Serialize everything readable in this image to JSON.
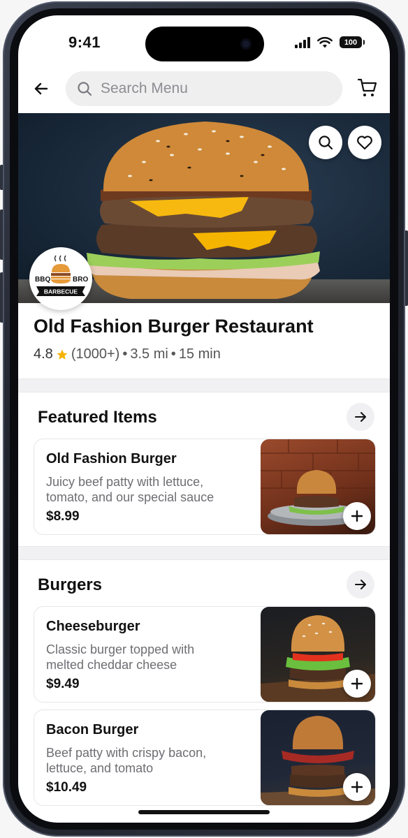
{
  "status_bar": {
    "time": "9:41",
    "battery": "100"
  },
  "header": {
    "search_placeholder": "Search Menu"
  },
  "logo": {
    "top_left": "BBQ",
    "top_right": "BRO",
    "ribbon": "BARBECUE"
  },
  "restaurant": {
    "name": "Old Fashion Burger Restaurant",
    "rating": "4.8",
    "reviews": "(1000+)",
    "distance": "3.5 mi",
    "time": "15 min"
  },
  "sections": [
    {
      "title": "Featured Items",
      "items": [
        {
          "name": "Old Fashion Burger",
          "description": "Juicy beef patty with lettuce, tomato, and our special sauce",
          "price": "$8.99"
        }
      ]
    },
    {
      "title": "Burgers",
      "items": [
        {
          "name": "Cheeseburger",
          "description": "Classic burger topped with melted cheddar cheese",
          "price": "$9.49"
        },
        {
          "name": "Bacon Burger",
          "description": "Beef patty with crispy bacon, lettuce, and tomato",
          "price": "$10.49"
        }
      ]
    }
  ],
  "colors": {
    "star": "#f5b400",
    "text": "#111111",
    "muted": "#6e6e73"
  }
}
